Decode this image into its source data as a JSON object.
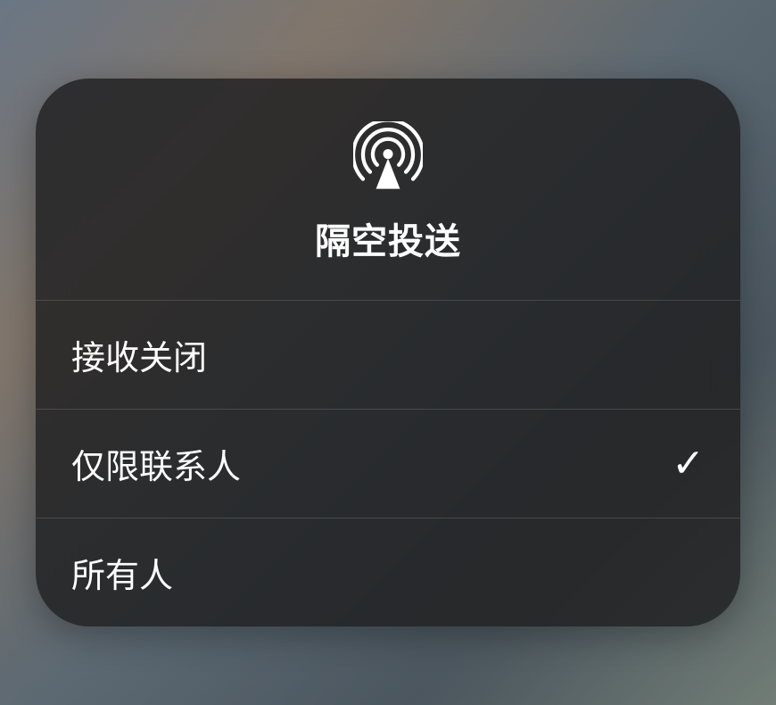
{
  "header": {
    "title": "隔空投送"
  },
  "options": {
    "receiving_off": {
      "label": "接收关闭",
      "selected": false
    },
    "contacts_only": {
      "label": "仅限联系人",
      "selected": true
    },
    "everyone": {
      "label": "所有人",
      "selected": false
    }
  }
}
